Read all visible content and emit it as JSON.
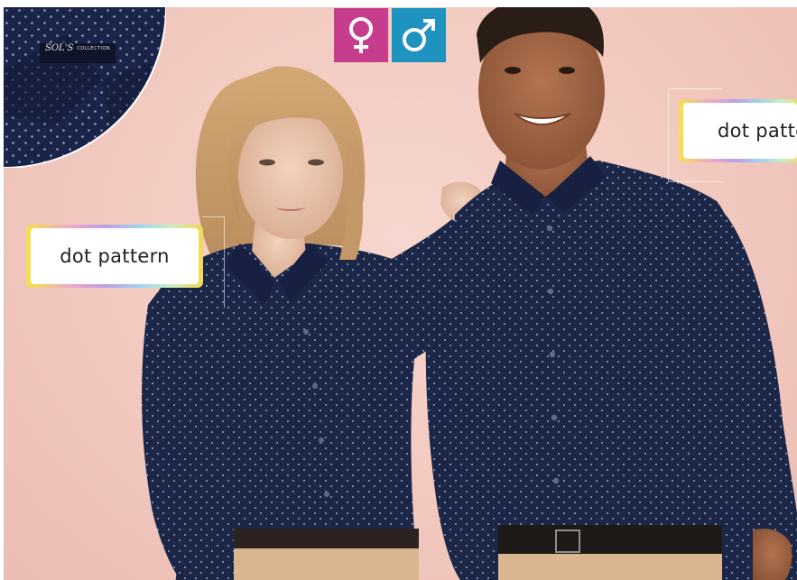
{
  "brand": {
    "logo_text": "SOL'S",
    "logo_sub": "COLLECTION"
  },
  "gender_icons": [
    {
      "name": "female-symbol-icon",
      "symbol": "♀",
      "color": "#c63d8e"
    },
    {
      "name": "male-symbol-icon",
      "symbol": "♂",
      "color": "#1f93bf"
    }
  ],
  "callouts": [
    {
      "text": "dot pattern"
    },
    {
      "text": "dot patte"
    }
  ],
  "colors": {
    "background": "#f2c9bf",
    "shirt": "#1c2747",
    "trousers": "#d9b690"
  }
}
